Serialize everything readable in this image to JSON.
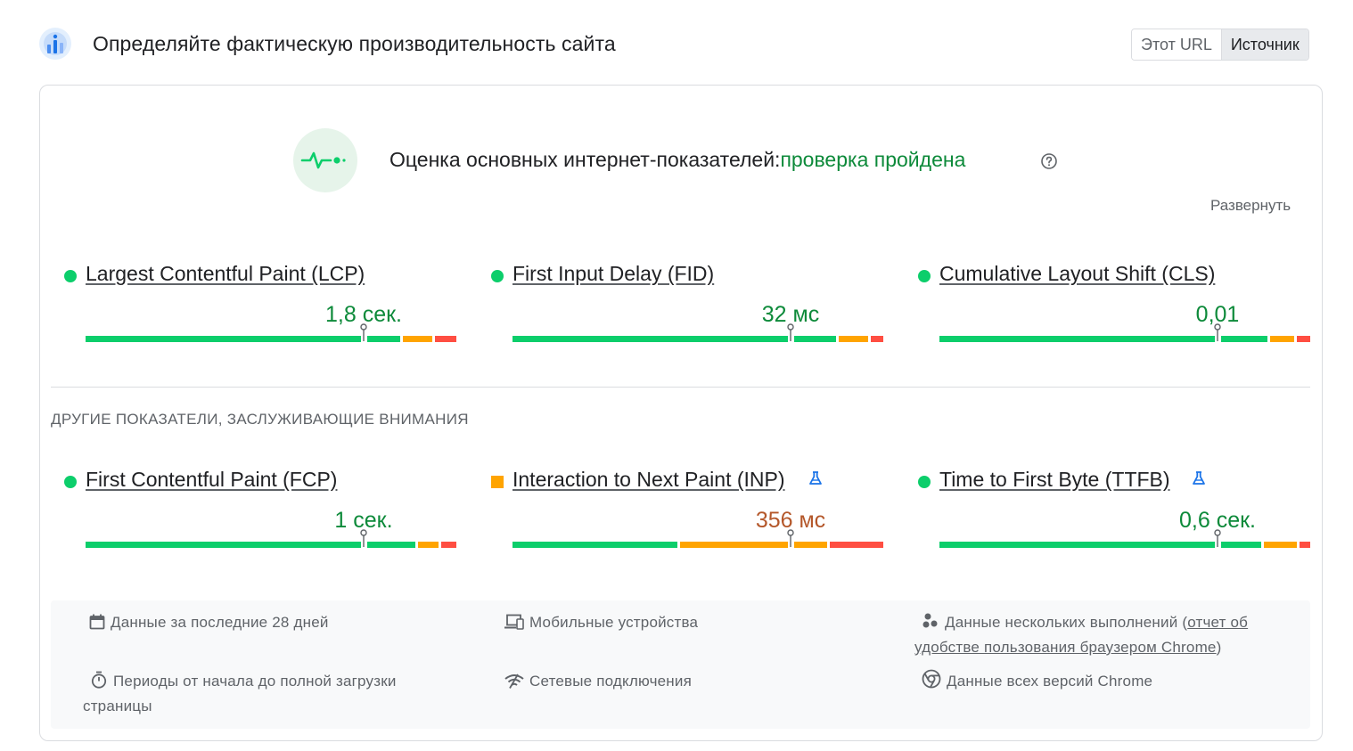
{
  "header": {
    "title": "Определяйте фактическую производительность сайта",
    "toggle": {
      "this_url": "Этот URL",
      "origin": "Источник",
      "selected": "origin"
    }
  },
  "assessment": {
    "label": "Оценка основных интернет-показателей:",
    "status": "проверка пройдена",
    "expand": "Развернуть"
  },
  "core_metrics": [
    {
      "name": "Largest Contentful Paint (LCP)",
      "value": "1,8 сек.",
      "rating": "good",
      "lab_icon": false
    },
    {
      "name": "First Input Delay (FID)",
      "value": "32 мс",
      "rating": "good",
      "lab_icon": false
    },
    {
      "name": "Cumulative Layout Shift (CLS)",
      "value": "0,01",
      "rating": "good",
      "lab_icon": false
    }
  ],
  "other_section_label": "ДРУГИЕ ПОКАЗАТЕЛИ, ЗАСЛУЖИВАЮЩИЕ ВНИМАНИЯ",
  "other_metrics": [
    {
      "name": "First Contentful Paint (FCP)",
      "value": "1 сек.",
      "rating": "good",
      "lab_icon": false
    },
    {
      "name": "Interaction to Next Paint (INP)",
      "value": "356 мс",
      "rating": "average",
      "lab_icon": true
    },
    {
      "name": "Time to First Byte (TTFB)",
      "value": "0,6 сек.",
      "rating": "good",
      "lab_icon": true
    }
  ],
  "info": {
    "period": "Данные за последние 28 дней",
    "devices": "Мобильные устройства",
    "runs_prefix": "Данные нескольких выполнений (",
    "runs_link": "отчет об удобстве пользования браузером Chrome",
    "runs_suffix": ")",
    "load": "Периоды от начала до полной загрузки страницы",
    "network": "Сетевые подключения",
    "chrome": "Данные всех версий Chrome"
  },
  "colors": {
    "good": "#0cce6b",
    "average": "#ffa400",
    "poor": "#ff4e42",
    "good_text": "#0d8a3a",
    "average_text": "#b4572a"
  }
}
